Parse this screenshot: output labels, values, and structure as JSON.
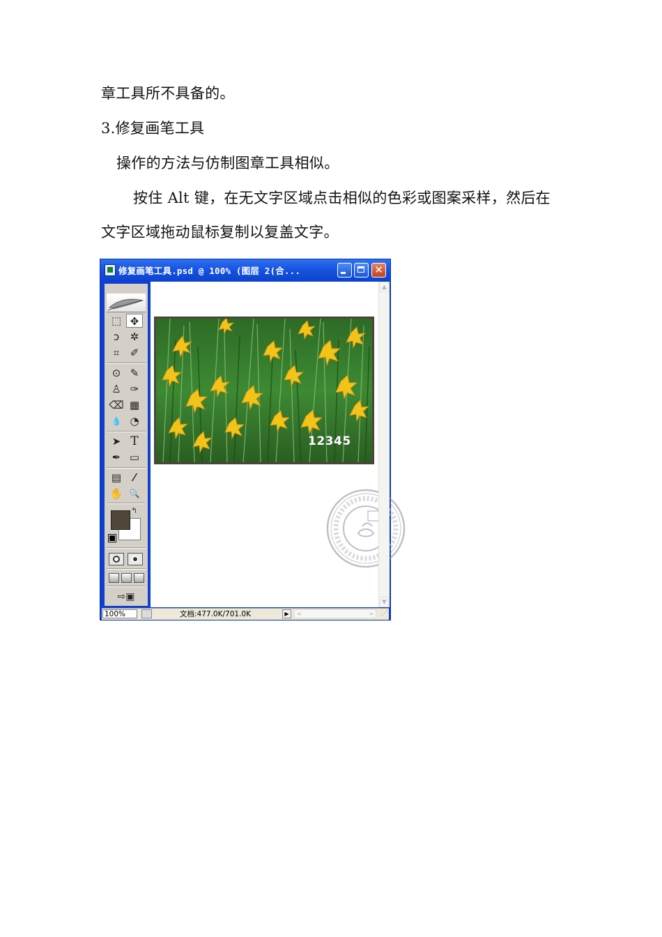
{
  "paragraphs": {
    "p1": "章工具所不具备的。",
    "p2": "3.修复画笔工具",
    "p3": "操作的方法与仿制图章工具相似。",
    "p4": "按住 Alt 键，在无文字区域点击相似的色彩或图案采样，然后在",
    "p5": "文字区域拖动鼠标复制以复盖文字。"
  },
  "window": {
    "title": "修复画笔工具.psd @ 100% (图层 2(合...",
    "close_glyph": "✕"
  },
  "tools": {
    "marquee": "⬚",
    "move": "✥",
    "lasso": "ↄ",
    "magic_wand": "✲",
    "crop": "⌗",
    "slice": "✐",
    "healing": "⊙",
    "brush": "✎",
    "stamp": "♙",
    "history_brush": "✑",
    "eraser": "⌫",
    "gradient": "▦",
    "blur": "💧",
    "dodge": "◔",
    "path_select": "➤",
    "type": "T",
    "pen": "✒",
    "shape": "▭",
    "notes": "▤",
    "eyedropper": "⁄",
    "hand": "✋",
    "zoom": "🔍",
    "swap": "↰",
    "jump": "⇨▣"
  },
  "colors": {
    "foreground": "#4e4637",
    "background": "#ffffff",
    "titlebar": "#1550de"
  },
  "image": {
    "overlay_text": "12345"
  },
  "statusbar": {
    "zoom": "100%",
    "doc_size": "文档:477.0K/701.0K",
    "arrow": "▶",
    "hscroll_left": "<",
    "hscroll_right": ">",
    "vscroll_up": "▲",
    "vscroll_down": "▼"
  }
}
